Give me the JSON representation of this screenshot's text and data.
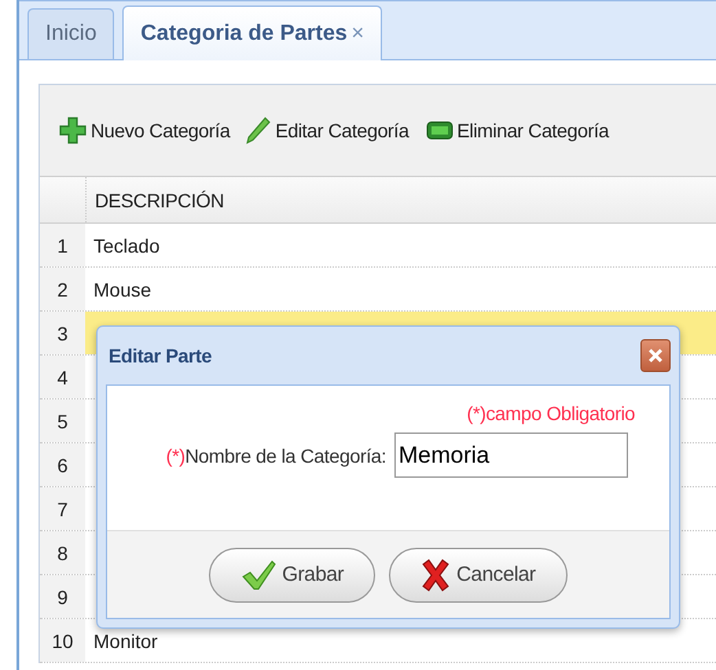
{
  "tabs": [
    {
      "label": "Inicio",
      "selected": false
    },
    {
      "label": "Categoria de Partes",
      "selected": true,
      "close_glyph": "×"
    }
  ],
  "toolbar": [
    {
      "kind": "add",
      "label": "Nuevo Categoría"
    },
    {
      "kind": "edit",
      "label": "Editar Categoría"
    },
    {
      "kind": "delete",
      "label": "Eliminar Categoría"
    }
  ],
  "table": {
    "columns": [
      "DESCRIPCIÓN"
    ],
    "rows": [
      {
        "number": "1",
        "description": "Teclado",
        "selected": false
      },
      {
        "number": "2",
        "description": "Mouse",
        "selected": false
      },
      {
        "number": "3",
        "selected": true
      },
      {
        "number": "4",
        "selected": false
      },
      {
        "number": "5",
        "selected": false
      },
      {
        "number": "6",
        "selected": false
      },
      {
        "number": "7",
        "selected": false
      },
      {
        "number": "8",
        "selected": false
      },
      {
        "number": "9",
        "selected": false
      },
      {
        "number": "10",
        "description": "Monitor",
        "selected": false
      }
    ]
  },
  "dialog": {
    "title": "Editar Parte",
    "required_note": "(*)campo Obligatorio",
    "field": {
      "required_mark": "(*)",
      "label": "Nombre de la Categoría:",
      "value": "Memoria"
    },
    "buttons": [
      {
        "kind": "save",
        "label": "Grabar"
      },
      {
        "kind": "cancel",
        "label": "Cancelar"
      }
    ]
  }
}
